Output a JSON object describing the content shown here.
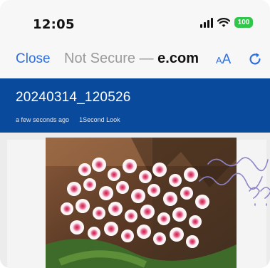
{
  "status_bar": {
    "time": "12:05",
    "battery": "100",
    "icons": [
      "signal-icon",
      "wifi-icon",
      "battery-icon"
    ]
  },
  "address_bar": {
    "close_label": "Close",
    "url_prefix": "Not Secure — ",
    "url_domain": "e.com",
    "text_size_small": "A",
    "text_size_large": "A",
    "reload_icon": "reload-icon"
  },
  "header": {
    "title": "20240314_120526",
    "time_ago": "a few seconds ago",
    "view_mode": "1Second Look"
  },
  "colors": {
    "accent": "#2f6fe0",
    "header_bg": "#0a4a9c",
    "battery": "#2fc64a"
  },
  "content": {
    "image_subject": "white and magenta phalaenopsis orchids",
    "annotation_text": "question words??"
  }
}
